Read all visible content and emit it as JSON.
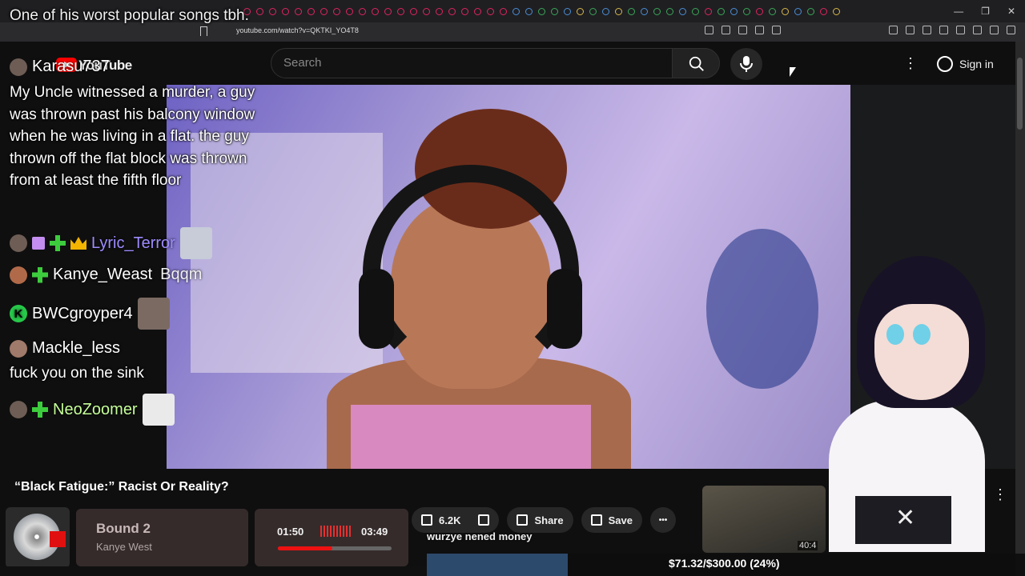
{
  "browser": {
    "url": "youtube.com/watch?v=QKTKI_YO4T8"
  },
  "masthead": {
    "logo_text": "YouTube",
    "search_placeholder": "Search",
    "signin_label": "Sign in"
  },
  "overlay": {
    "top_message": "One of his worst popular songs tbh."
  },
  "chat": {
    "messages": [
      {
        "user": "Karasu737",
        "text": "My Uncle witnessed a murder, a guy was thrown past his balcony window when he was living in a flat. the guy thrown off the flat block was thrown from at least the fifth floor"
      },
      {
        "user": "Lyric_Terror",
        "text": ""
      },
      {
        "user": "Kanye_Weast",
        "text": "Bqqm"
      },
      {
        "user": "BWCgroyper4",
        "text": ""
      },
      {
        "user": "Mackle_less",
        "text": "fuck you on the sink"
      },
      {
        "user": "NeoZoomer",
        "text": ""
      }
    ],
    "badge_k_letter": "K"
  },
  "video": {
    "title": "“Black Fatigue:” Racist Or Reality?",
    "likes": "6.2K",
    "share_label": "Share",
    "save_label": "Save",
    "more_label": "•••",
    "related_duration": "40:4"
  },
  "music": {
    "song": "Bound 2",
    "artist": "Kanye West",
    "current_time": "01:50",
    "total_time": "03:49",
    "progress": 0.48
  },
  "ticker_text": "wurzye nened money",
  "goal": {
    "text": "$71.32/$300.00 (24%)",
    "progress": 0.24
  },
  "colors": {
    "yt_red": "#ff0000",
    "goal_fill": "#2c4a6c",
    "progress_red": "#ee1111"
  }
}
